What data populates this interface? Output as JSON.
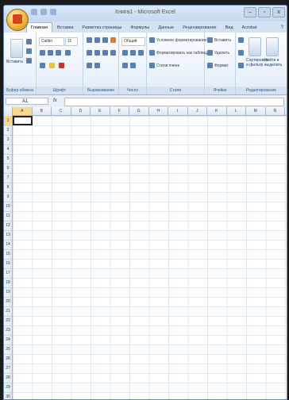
{
  "window": {
    "title": "Книга1 - Microsoft Excel",
    "controls": [
      "–",
      "▫",
      "x"
    ]
  },
  "tabs": [
    {
      "label": "Главная",
      "active": true
    },
    {
      "label": "Вставка"
    },
    {
      "label": "Разметка страницы"
    },
    {
      "label": "Формулы"
    },
    {
      "label": "Данные"
    },
    {
      "label": "Рецензирование"
    },
    {
      "label": "Вид"
    },
    {
      "label": "Acrobat"
    }
  ],
  "ribbon": {
    "clipboard": {
      "paste": "Вставить",
      "group": "Буфер обмена"
    },
    "font": {
      "name": "Calibri",
      "size": "11",
      "group": "Шрифт"
    },
    "alignment": {
      "group": "Выравнивание"
    },
    "number": {
      "format": "Общий",
      "group": "Число"
    },
    "styles": {
      "cond": "Условное форматирование",
      "table": "Форматировать как таблицу",
      "cell": "Стили ячеек",
      "group": "Стили"
    },
    "cells": {
      "insert": "Вставить",
      "delete": "Удалить",
      "format": "Формат",
      "group": "Ячейки"
    },
    "editing": {
      "sort": "Сортировка и фильтр",
      "find": "Найти и выделить",
      "group": "Редактирование"
    }
  },
  "formula_bar": {
    "name_box": "A1",
    "fx": "fx",
    "value": ""
  },
  "sheet": {
    "columns": [
      "A",
      "B",
      "C",
      "D",
      "E",
      "F",
      "G",
      "H",
      "I",
      "J",
      "K",
      "L",
      "M",
      "N"
    ],
    "rows": [
      "1",
      "2",
      "3",
      "4",
      "5",
      "6",
      "7",
      "8",
      "9",
      "10",
      "11",
      "12",
      "13",
      "14",
      "15",
      "16",
      "17",
      "18",
      "19",
      "20",
      "21",
      "22",
      "23",
      "24",
      "25",
      "26",
      "27",
      "28",
      "29",
      "30"
    ],
    "active_cell": "A1"
  }
}
